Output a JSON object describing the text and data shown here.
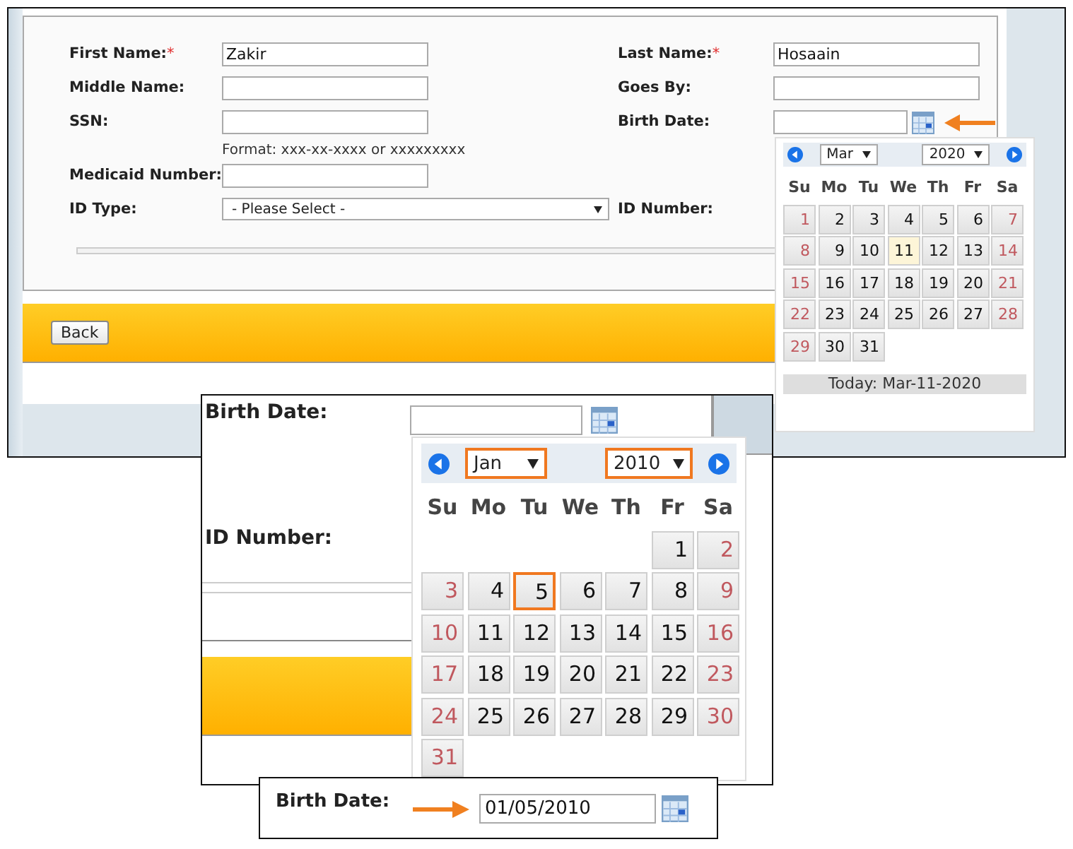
{
  "form_panel": {
    "rows": [
      {
        "left": {
          "label": "First Name:",
          "marker": "*",
          "kind": "text",
          "value": "Zakir"
        },
        "right": {
          "label": "Last Name:",
          "marker": "*",
          "kind": "text",
          "value": "Hosaain"
        }
      },
      {
        "left": {
          "label": "Middle Name:",
          "kind": "text"
        },
        "right": {
          "label": "Goes By:",
          "kind": "text"
        }
      },
      {
        "left": {
          "label": "SSN:",
          "kind": "text",
          "note": "Format: xxx-xx-xxxx or xxxxxxxxx"
        },
        "right": {
          "label": "Birth Date:",
          "kind": "date"
        }
      },
      {
        "left": {
          "label": "Medicaid Number:",
          "kind": "text"
        }
      },
      {
        "left": {
          "label": "ID Type:",
          "kind": "select",
          "value": "- Please Select -"
        },
        "right": {
          "label": "ID Number:",
          "kind": "label"
        }
      }
    ],
    "back_button": "Back",
    "calendar": {
      "month": "Mar",
      "year": "2020",
      "highlighted": false,
      "weekdays": [
        "Su",
        "Mo",
        "Tu",
        "We",
        "Th",
        "Fr",
        "Sa"
      ],
      "weeks": [
        [
          {
            "day": "1",
            "today": false,
            "selected": false
          },
          {
            "day": "2",
            "today": false,
            "selected": false
          },
          {
            "day": "3",
            "today": false,
            "selected": false
          },
          {
            "day": "4",
            "today": false,
            "selected": false
          },
          {
            "day": "5",
            "today": false,
            "selected": false
          },
          {
            "day": "6",
            "today": false,
            "selected": false
          },
          {
            "day": "7",
            "today": false,
            "selected": false
          }
        ],
        [
          {
            "day": "8",
            "today": false,
            "selected": false
          },
          {
            "day": "9",
            "today": false,
            "selected": false
          },
          {
            "day": "10",
            "today": false,
            "selected": false
          },
          {
            "day": "11",
            "today": true,
            "selected": false
          },
          {
            "day": "12",
            "today": false,
            "selected": false
          },
          {
            "day": "13",
            "today": false,
            "selected": false
          },
          {
            "day": "14",
            "today": false,
            "selected": false
          }
        ],
        [
          {
            "day": "15",
            "today": false,
            "selected": false
          },
          {
            "day": "16",
            "today": false,
            "selected": false
          },
          {
            "day": "17",
            "today": false,
            "selected": false
          },
          {
            "day": "18",
            "today": false,
            "selected": false
          },
          {
            "day": "19",
            "today": false,
            "selected": false
          },
          {
            "day": "20",
            "today": false,
            "selected": false
          },
          {
            "day": "21",
            "today": false,
            "selected": false
          }
        ],
        [
          {
            "day": "22",
            "today": false,
            "selected": false
          },
          {
            "day": "23",
            "today": false,
            "selected": false
          },
          {
            "day": "24",
            "today": false,
            "selected": false
          },
          {
            "day": "25",
            "today": false,
            "selected": false
          },
          {
            "day": "26",
            "today": false,
            "selected": false
          },
          {
            "day": "27",
            "today": false,
            "selected": false
          },
          {
            "day": "28",
            "today": false,
            "selected": false
          }
        ],
        [
          {
            "day": "29",
            "today": false,
            "selected": false
          },
          {
            "day": "30",
            "today": false,
            "selected": false
          },
          {
            "day": "31",
            "today": false,
            "selected": false
          }
        ]
      ],
      "footer": "Today: Mar-11-2020"
    }
  },
  "zoom_panel": {
    "birth_date_label": "Birth Date:",
    "id_number_label": "ID Number:",
    "calendar": {
      "month": "Jan",
      "year": "2010",
      "highlighted": true,
      "weekdays": [
        "Su",
        "Mo",
        "Tu",
        "We",
        "Th",
        "Fr",
        "Sa"
      ],
      "weeks": [
        {
          "align_end": true,
          "days": [
            {
              "day": "1",
              "today": false,
              "selected": false
            },
            {
              "day": "2",
              "today": false,
              "selected": false
            }
          ]
        },
        [
          {
            "day": "3",
            "today": false,
            "selected": false
          },
          {
            "day": "4",
            "today": false,
            "selected": false
          },
          {
            "day": "5",
            "today": false,
            "selected": true
          },
          {
            "day": "6",
            "today": false,
            "selected": false
          },
          {
            "day": "7",
            "today": false,
            "selected": false
          },
          {
            "day": "8",
            "today": false,
            "selected": false
          },
          {
            "day": "9",
            "today": false,
            "selected": false
          }
        ],
        [
          {
            "day": "10",
            "today": false,
            "selected": false
          },
          {
            "day": "11",
            "today": false,
            "selected": false
          },
          {
            "day": "12",
            "today": false,
            "selected": false
          },
          {
            "day": "13",
            "today": false,
            "selected": false
          },
          {
            "day": "14",
            "today": false,
            "selected": false
          },
          {
            "day": "15",
            "today": false,
            "selected": false
          },
          {
            "day": "16",
            "today": false,
            "selected": false
          }
        ],
        [
          {
            "day": "17",
            "today": false,
            "selected": false
          },
          {
            "day": "18",
            "today": false,
            "selected": false
          },
          {
            "day": "19",
            "today": false,
            "selected": false
          },
          {
            "day": "20",
            "today": false,
            "selected": false
          },
          {
            "day": "21",
            "today": false,
            "selected": false
          },
          {
            "day": "22",
            "today": false,
            "selected": false
          },
          {
            "day": "23",
            "today": false,
            "selected": false
          }
        ],
        [
          {
            "day": "24",
            "today": false,
            "selected": false
          },
          {
            "day": "25",
            "today": false,
            "selected": false
          },
          {
            "day": "26",
            "today": false,
            "selected": false
          },
          {
            "day": "27",
            "today": false,
            "selected": false
          },
          {
            "day": "28",
            "today": false,
            "selected": false
          },
          {
            "day": "29",
            "today": false,
            "selected": false
          },
          {
            "day": "30",
            "today": false,
            "selected": false
          }
        ],
        [
          {
            "day": "31",
            "today": false,
            "selected": false
          }
        ]
      ]
    }
  },
  "result_panel": {
    "label": "Birth Date:",
    "value": "01/05/2010"
  }
}
